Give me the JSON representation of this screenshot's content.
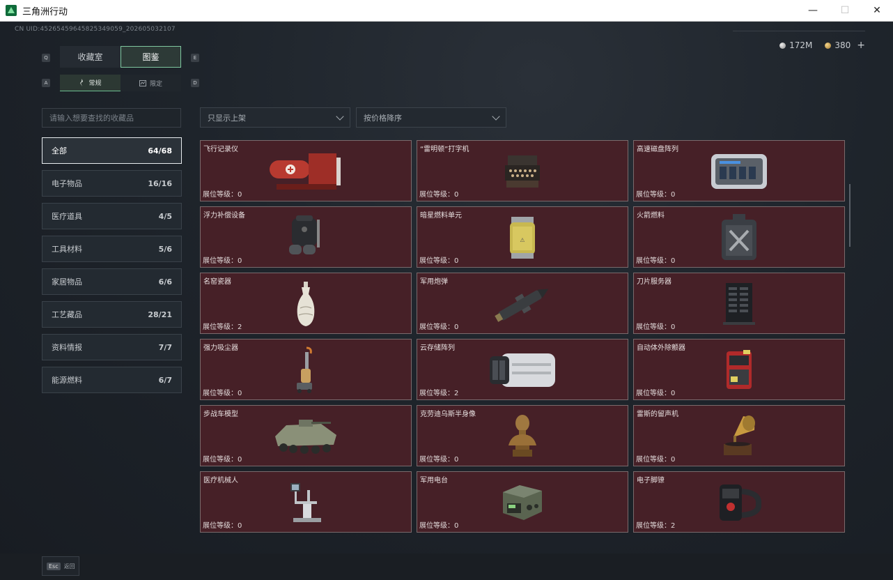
{
  "window": {
    "title": "三角洲行动",
    "minimize": "—",
    "maximize": "☐",
    "close": "✕"
  },
  "uid": "CN UID:4526545964582534905​9_202605032107",
  "currency": {
    "silver": "172M",
    "gold": "380",
    "plus": "+"
  },
  "keys": {
    "q": "Q",
    "e": "E",
    "a": "A",
    "d": "D"
  },
  "tabs": [
    {
      "label": "收藏室"
    },
    {
      "label": "图鉴"
    }
  ],
  "subtabs": [
    {
      "label": "常规"
    },
    {
      "label": "限定"
    }
  ],
  "search": {
    "placeholder": "请输入想要查找的收藏品"
  },
  "filters": {
    "display": "只显示上架",
    "sort": "按价格降序"
  },
  "categories": [
    {
      "label": "全部",
      "count": "64/68"
    },
    {
      "label": "电子物品",
      "count": "16/16"
    },
    {
      "label": "医疗道具",
      "count": "4/5"
    },
    {
      "label": "工具材料",
      "count": "5/6"
    },
    {
      "label": "家居物品",
      "count": "6/6"
    },
    {
      "label": "工艺藏品",
      "count": "28/21"
    },
    {
      "label": "资料情报",
      "count": "7/7"
    },
    {
      "label": "能源燃料",
      "count": "6/7"
    }
  ],
  "items": [
    {
      "name": "飞行记录仪",
      "level": "展位等级：0",
      "icon": "flight-recorder-icon"
    },
    {
      "name": "“雷明顿”打字机",
      "level": "展位等级：0",
      "icon": "typewriter-icon"
    },
    {
      "name": "高速磁盘阵列",
      "level": "展位等级：0",
      "icon": "disk-array-icon"
    },
    {
      "name": "浮力补偿设备",
      "level": "展位等级：0",
      "icon": "buoyancy-device-icon"
    },
    {
      "name": "暗星燃料单元",
      "level": "展位等级：0",
      "icon": "fuel-cell-icon"
    },
    {
      "name": "火箭燃料",
      "level": "展位等级：0",
      "icon": "rocket-fuel-icon"
    },
    {
      "name": "名窑瓷器",
      "level": "展位等级：2",
      "icon": "porcelain-vase-icon"
    },
    {
      "name": "军用炮弹",
      "level": "展位等级：0",
      "icon": "artillery-shell-icon"
    },
    {
      "name": "刀片服务器",
      "level": "展位等级：0",
      "icon": "blade-server-icon"
    },
    {
      "name": "强力吸尘器",
      "level": "展位等级：0",
      "icon": "vacuum-cleaner-icon"
    },
    {
      "name": "云存储阵列",
      "level": "展位等级：2",
      "icon": "cloud-storage-icon"
    },
    {
      "name": "自动体外除颤器",
      "level": "展位等级：0",
      "icon": "defibrillator-icon"
    },
    {
      "name": "步战车模型",
      "level": "展位等级：0",
      "icon": "ifv-model-icon"
    },
    {
      "name": "克劳迪乌斯半身像",
      "level": "展位等级：0",
      "icon": "bust-icon"
    },
    {
      "name": "雷斯的留声机",
      "level": "展位等级：0",
      "icon": "gramophone-icon"
    },
    {
      "name": "医疗机械人",
      "level": "展位等级：0",
      "icon": "medical-robot-icon"
    },
    {
      "name": "军用电台",
      "level": "展位等级：0",
      "icon": "military-radio-icon"
    },
    {
      "name": "电子脚镣",
      "level": "展位等级：2",
      "icon": "electronic-anklet-icon"
    }
  ],
  "footer": {
    "esc_key": "Esc",
    "back": "返回"
  }
}
